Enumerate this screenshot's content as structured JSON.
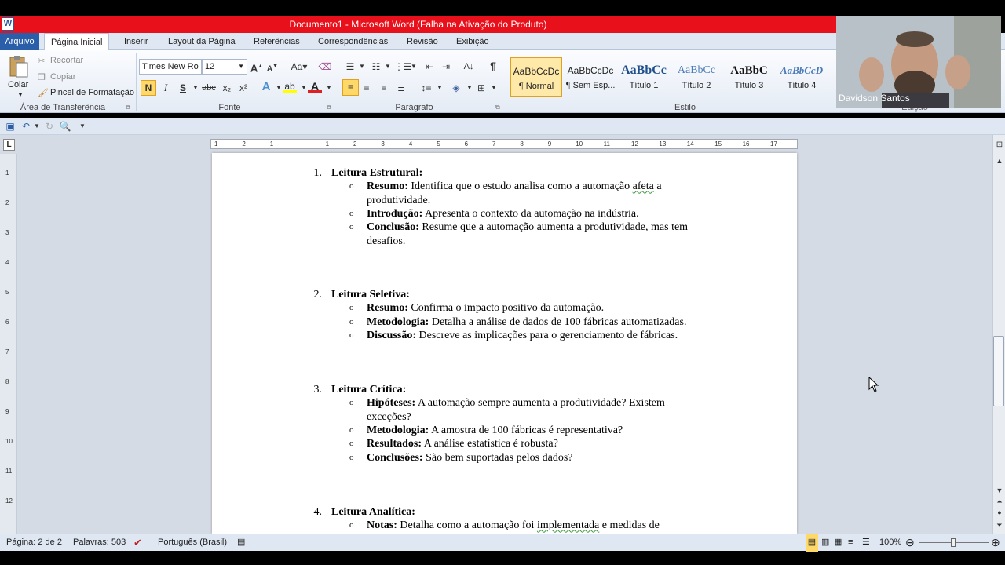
{
  "window": {
    "title": "Documento1 - Microsoft Word (Falha na Ativação do Produto)",
    "app_icon_letter": "W"
  },
  "tabs": [
    "Arquivo",
    "Página Inicial",
    "Inserir",
    "Layout da Página",
    "Referências",
    "Correspondências",
    "Revisão",
    "Exibição"
  ],
  "clipboard": {
    "paste": "Colar",
    "cut": "Recortar",
    "copy": "Copiar",
    "format_painter": "Pincel de Formatação",
    "group": "Área de Transferência"
  },
  "font": {
    "name": "Times New Ro",
    "size": "12",
    "bold": "N",
    "italic": "I",
    "underline": "S",
    "strike": "abc",
    "sub": "x₂",
    "sup": "x²",
    "group": "Fonte",
    "grow": "A",
    "shrink": "A",
    "case": "Aa"
  },
  "paragraph": {
    "group": "Parágrafo"
  },
  "styles": {
    "group": "Estilo",
    "items": [
      {
        "sample": "AaBbCcDc",
        "name": "¶ Normal"
      },
      {
        "sample": "AaBbCcDc",
        "name": "¶ Sem Esp..."
      },
      {
        "sample": "AaBbCc",
        "name": "Título 1"
      },
      {
        "sample": "AaBbCc",
        "name": "Título 2"
      },
      {
        "sample": "AaBbC",
        "name": "Título 3"
      },
      {
        "sample": "AaBbCcD",
        "name": "Título 4"
      }
    ]
  },
  "editing": {
    "group": "Edição"
  },
  "ruler": {
    "corner": "L",
    "h_ticks": [
      "1",
      "2",
      "1",
      "",
      "1",
      "2",
      "3",
      "4",
      "5",
      "6",
      "7",
      "8",
      "9",
      "10",
      "11",
      "12",
      "13",
      "14",
      "15",
      "16",
      "17"
    ],
    "v_ticks": [
      "1",
      "2",
      "3",
      "4",
      "5",
      "6",
      "7",
      "8",
      "9",
      "10",
      "11",
      "12"
    ]
  },
  "document": {
    "sections": [
      {
        "num": "1.",
        "title": "Leitura Estrutural:",
        "items": [
          {
            "label": "Resumo:",
            "lines": [
              "Identifica que o estudo analisa como a automação afeta a",
              "produtividade."
            ]
          },
          {
            "label": "Introdução:",
            "lines": [
              "Apresenta o contexto da automação na indústria."
            ]
          },
          {
            "label": "Conclusão:",
            "lines": [
              "Resume que a automação aumenta a produtividade, mas tem",
              "desafios."
            ]
          }
        ]
      },
      {
        "num": "2.",
        "title": "Leitura Seletiva:",
        "items": [
          {
            "label": "Resumo:",
            "lines": [
              "Confirma o impacto positivo da automação."
            ]
          },
          {
            "label": "Metodologia:",
            "lines": [
              "Detalha a análise de dados de 100 fábricas automatizadas."
            ]
          },
          {
            "label": "Discussão:",
            "lines": [
              "Descreve as implicações para o gerenciamento de fábricas."
            ]
          }
        ]
      },
      {
        "num": "3.",
        "title": "Leitura Crítica:",
        "items": [
          {
            "label": "Hipóteses:",
            "lines": [
              "A automação sempre aumenta a produtividade? Existem",
              "exceções?"
            ]
          },
          {
            "label": "Metodologia:",
            "lines": [
              "A amostra de 100 fábricas é representativa?"
            ]
          },
          {
            "label": "Resultados:",
            "lines": [
              "A análise estatística é robusta?"
            ]
          },
          {
            "label": "Conclusões:",
            "lines": [
              "São bem suportadas pelos dados?"
            ]
          }
        ]
      },
      {
        "num": "4.",
        "title": "Leitura Analítica:",
        "items": [
          {
            "label": "Notas:",
            "lines": [
              "Detalha como a automação foi implementada e medidas de"
            ]
          }
        ]
      }
    ],
    "bullet": "o"
  },
  "status": {
    "page": "Página: 2 de 2",
    "words": "Palavras: 503",
    "language": "Português (Brasil)",
    "zoom": "100%"
  },
  "webcam": {
    "name": "Davidson Santos"
  }
}
